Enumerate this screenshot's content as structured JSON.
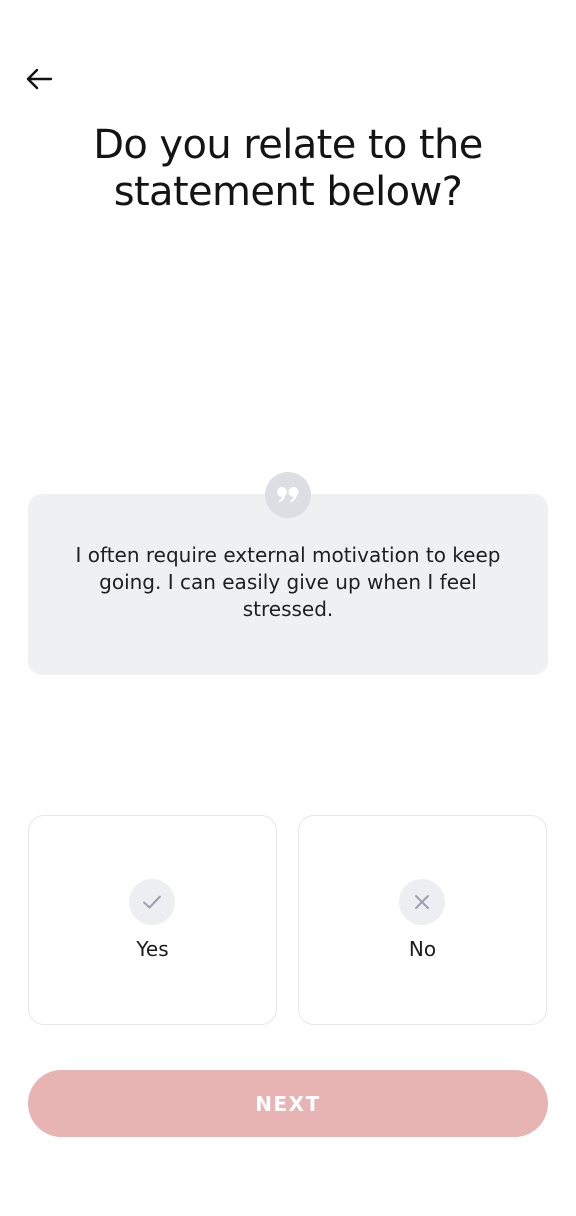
{
  "header": {
    "back_icon": "arrow-left-icon",
    "title": "Do you relate to the statement below?"
  },
  "statement": {
    "quote_icon": "quote-icon",
    "text": "I often require external motivation to keep going. I can easily give up when I feel stressed."
  },
  "options": [
    {
      "label": "Yes",
      "icon": "check-icon"
    },
    {
      "label": "No",
      "icon": "close-icon"
    }
  ],
  "next_button": {
    "label": "NEXT",
    "color": "#e8b3b3"
  },
  "colors": {
    "card_background": "#eff0f2",
    "icon_circle": "#eceef2",
    "icon_glyph": "#9aa0ae"
  }
}
